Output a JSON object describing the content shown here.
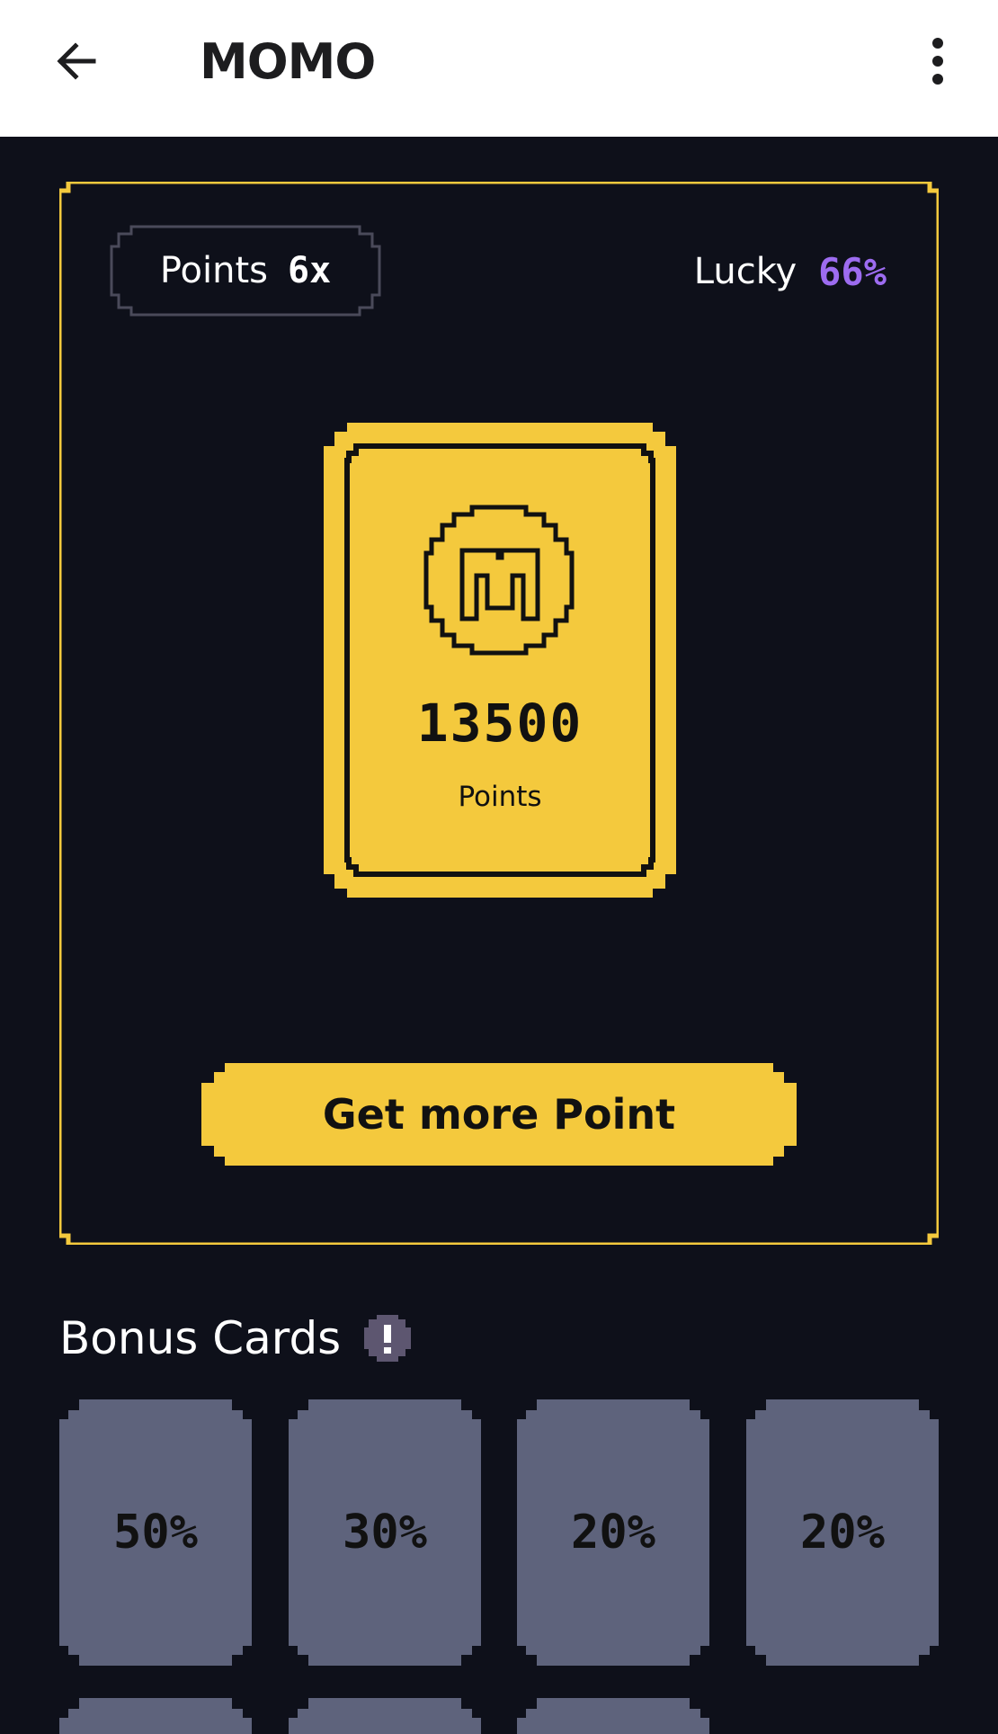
{
  "appbar": {
    "title": "MOMO",
    "back_icon": "arrow-left-icon",
    "menu_icon": "more-vertical-icon"
  },
  "stats": {
    "points_label": "Points",
    "points_multiplier": "6x",
    "lucky_label": "Lucky",
    "lucky_value": "66%"
  },
  "card": {
    "icon": "momo-coin-icon",
    "amount": "13500",
    "unit": "Points"
  },
  "actions": {
    "get_more_label": "Get more Point"
  },
  "bonus": {
    "title": "Bonus Cards",
    "info_icon": "info-icon",
    "cards": [
      "50%",
      "30%",
      "20%",
      "20%"
    ]
  },
  "colors": {
    "background": "#0e101a",
    "accent_yellow": "#f4c93d",
    "lucky_purple": "#9d6cf0",
    "bonus_card": "#5e637c",
    "info_badge": "#5d5670"
  }
}
